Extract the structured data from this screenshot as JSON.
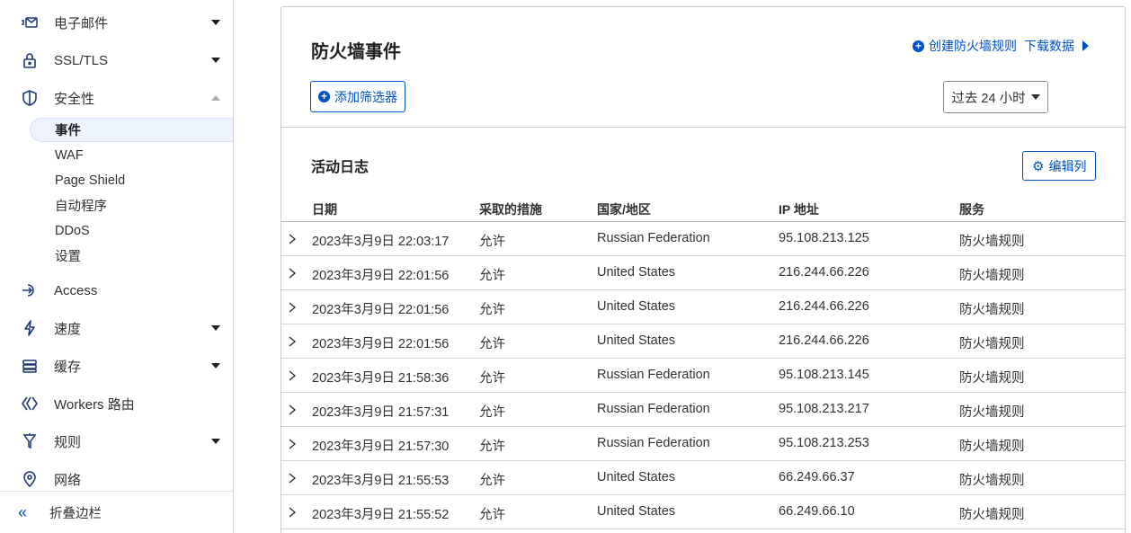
{
  "sidebar": {
    "items": [
      {
        "label": "电子邮件",
        "icon": "email-routing-icon",
        "caret": "down"
      },
      {
        "label": "SSL/TLS",
        "icon": "lock-icon",
        "caret": "down"
      },
      {
        "label": "安全性",
        "icon": "shield-icon",
        "caret": "up"
      },
      {
        "label": "Access",
        "icon": "access-icon",
        "caret": "none"
      },
      {
        "label": "速度",
        "icon": "lightning-icon",
        "caret": "down"
      },
      {
        "label": "缓存",
        "icon": "cache-stack-icon",
        "caret": "down"
      },
      {
        "label": "Workers 路由",
        "icon": "workers-icon",
        "caret": "none"
      },
      {
        "label": "规则",
        "icon": "rules-funnel-icon",
        "caret": "down"
      },
      {
        "label": "网络",
        "icon": "location-pin-icon",
        "caret": "none"
      }
    ],
    "security_sub": [
      {
        "label": "事件",
        "active": true
      },
      {
        "label": "WAF"
      },
      {
        "label": "Page Shield"
      },
      {
        "label": "自动程序"
      },
      {
        "label": "DDoS"
      },
      {
        "label": "设置"
      }
    ],
    "collapse_label": "折叠边栏"
  },
  "main": {
    "title": "防火墙事件",
    "create_rule": "创建防火墙规则",
    "download": "下载数据",
    "add_filter": "添加筛选器",
    "time_range": "过去 24 小时",
    "section_title": "活动日志",
    "edit_columns": "编辑列",
    "table": {
      "headers": {
        "date": "日期",
        "action": "采取的措施",
        "country": "国家/地区",
        "ip": "IP 地址",
        "service": "服务"
      },
      "rows": [
        {
          "date": "2023年3月9日 22:03:17",
          "action": "允许",
          "country": "Russian Federation",
          "ip": "95.108.213.125",
          "service": "防火墙规则"
        },
        {
          "date": "2023年3月9日 22:01:56",
          "action": "允许",
          "country": "United States",
          "ip": "216.244.66.226",
          "service": "防火墙规则"
        },
        {
          "date": "2023年3月9日 22:01:56",
          "action": "允许",
          "country": "United States",
          "ip": "216.244.66.226",
          "service": "防火墙规则"
        },
        {
          "date": "2023年3月9日 22:01:56",
          "action": "允许",
          "country": "United States",
          "ip": "216.244.66.226",
          "service": "防火墙规则"
        },
        {
          "date": "2023年3月9日 21:58:36",
          "action": "允许",
          "country": "Russian Federation",
          "ip": "95.108.213.145",
          "service": "防火墙规则"
        },
        {
          "date": "2023年3月9日 21:57:31",
          "action": "允许",
          "country": "Russian Federation",
          "ip": "95.108.213.217",
          "service": "防火墙规则"
        },
        {
          "date": "2023年3月9日 21:57:30",
          "action": "允许",
          "country": "Russian Federation",
          "ip": "95.108.213.253",
          "service": "防火墙规则"
        },
        {
          "date": "2023年3月9日 21:55:53",
          "action": "允许",
          "country": "United States",
          "ip": "66.249.66.37",
          "service": "防火墙规则"
        },
        {
          "date": "2023年3月9日 21:55:52",
          "action": "允许",
          "country": "United States",
          "ip": "66.249.66.10",
          "service": "防火墙规则"
        }
      ]
    }
  },
  "colors": {
    "accent": "#0051c3",
    "active_bg": "#eef4fd",
    "text": "#313131"
  }
}
